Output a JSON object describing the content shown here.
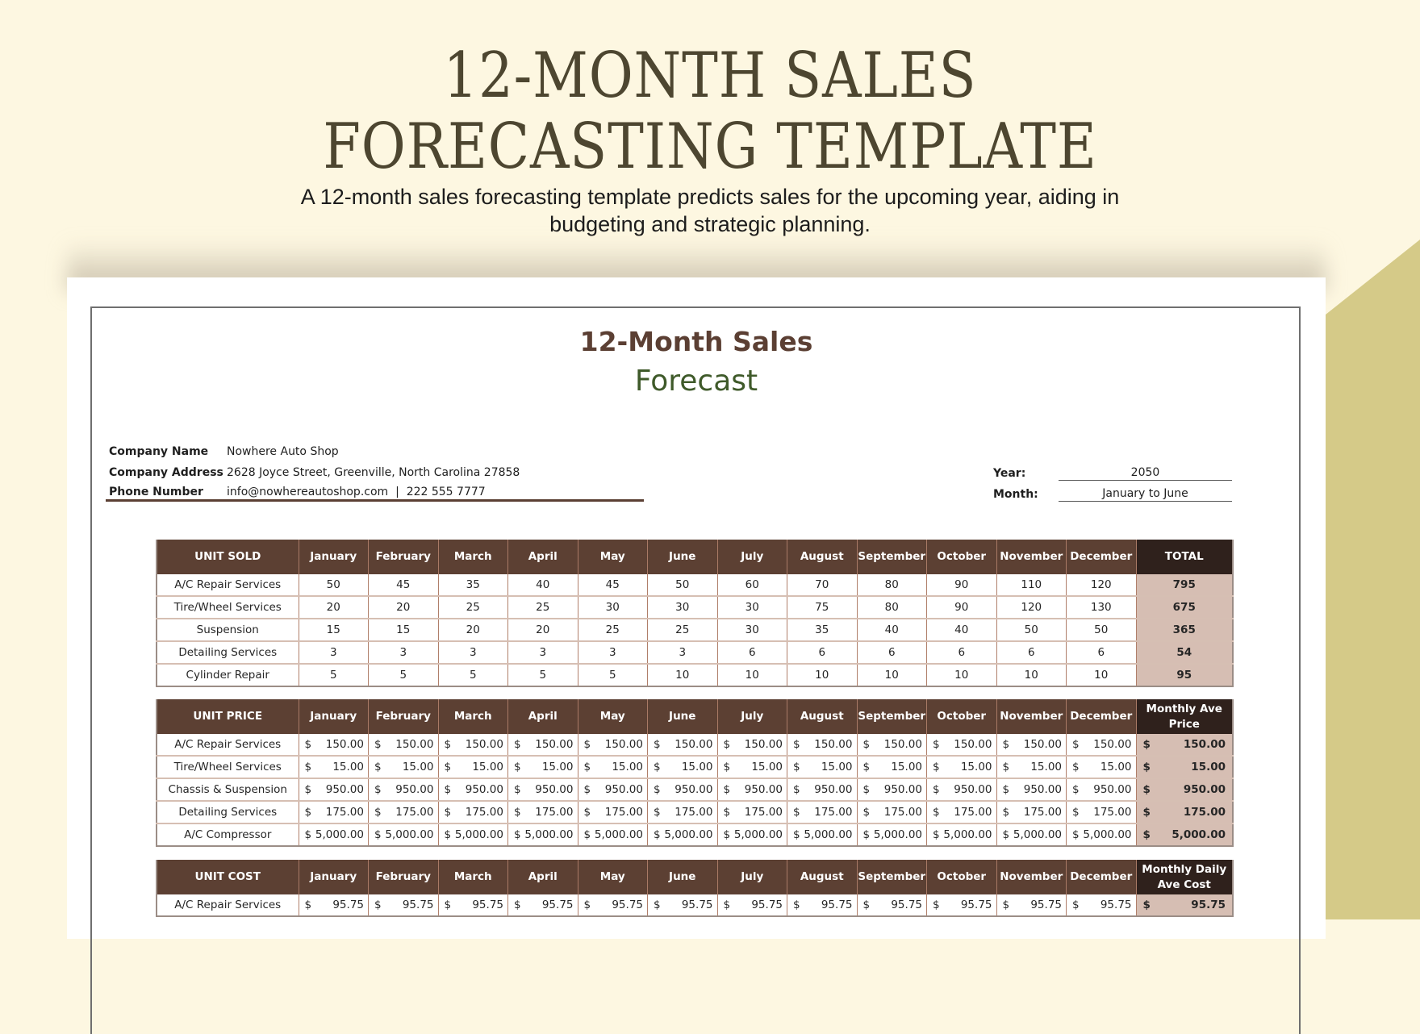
{
  "hero": {
    "title_line1": "12-MONTH SALES",
    "title_line2": "FORECASTING TEMPLATE",
    "subtitle_line1": "A 12-month sales forecasting template predicts sales for the upcoming year, aiding in",
    "subtitle_line2": "budgeting and strategic planning."
  },
  "document": {
    "title": "12-Month Sales",
    "subtitle": "Forecast",
    "company": {
      "name_label": "Company Name",
      "name": "Nowhere Auto Shop",
      "address_label": "Company Address",
      "address": "2628 Joyce Street, Greenville, North Carolina 27858",
      "phone_label": "Phone Number",
      "phone": "info@nowhereautoshop.com  |  222 555 7777"
    },
    "period": {
      "year_label": "Year:",
      "year": "2050",
      "month_label": "Month:",
      "month": "January to June"
    }
  },
  "months": [
    "January",
    "February",
    "March",
    "April",
    "May",
    "June",
    "July",
    "August",
    "September",
    "October",
    "November",
    "December"
  ],
  "colors": {
    "header_brown": "#5c4033",
    "total_header": "#2f211c",
    "total_cell": "#d6beb3",
    "title_brown": "#5b3f33",
    "title_green": "#3f5a2a",
    "background": "#fdf7e1",
    "accent_gold": "#d5ca88"
  },
  "unit_sold": {
    "header": "UNIT SOLD",
    "total_header": "TOTAL",
    "rows": [
      {
        "name": "A/C Repair Services",
        "values": [
          "50",
          "45",
          "35",
          "40",
          "45",
          "50",
          "60",
          "70",
          "80",
          "90",
          "110",
          "120"
        ],
        "total": "795"
      },
      {
        "name": "Tire/Wheel Services",
        "values": [
          "20",
          "20",
          "25",
          "25",
          "30",
          "30",
          "30",
          "75",
          "80",
          "90",
          "120",
          "130"
        ],
        "total": "675"
      },
      {
        "name": "Suspension",
        "values": [
          "15",
          "15",
          "20",
          "20",
          "25",
          "25",
          "30",
          "35",
          "40",
          "40",
          "50",
          "50"
        ],
        "total": "365"
      },
      {
        "name": "Detailing Services",
        "values": [
          "3",
          "3",
          "3",
          "3",
          "3",
          "3",
          "6",
          "6",
          "6",
          "6",
          "6",
          "6"
        ],
        "total": "54"
      },
      {
        "name": "Cylinder Repair",
        "values": [
          "5",
          "5",
          "5",
          "5",
          "5",
          "10",
          "10",
          "10",
          "10",
          "10",
          "10",
          "10"
        ],
        "total": "95"
      }
    ]
  },
  "unit_price": {
    "header": "UNIT PRICE",
    "total_header_line1": "Monthly Ave",
    "total_header_line2": "Price",
    "currency": "$",
    "rows": [
      {
        "name": "A/C Repair Services",
        "values": [
          "150.00",
          "150.00",
          "150.00",
          "150.00",
          "150.00",
          "150.00",
          "150.00",
          "150.00",
          "150.00",
          "150.00",
          "150.00",
          "150.00"
        ],
        "total": "150.00"
      },
      {
        "name": "Tire/Wheel Services",
        "values": [
          "15.00",
          "15.00",
          "15.00",
          "15.00",
          "15.00",
          "15.00",
          "15.00",
          "15.00",
          "15.00",
          "15.00",
          "15.00",
          "15.00"
        ],
        "total": "15.00"
      },
      {
        "name": "Chassis & Suspension",
        "values": [
          "950.00",
          "950.00",
          "950.00",
          "950.00",
          "950.00",
          "950.00",
          "950.00",
          "950.00",
          "950.00",
          "950.00",
          "950.00",
          "950.00"
        ],
        "total": "950.00"
      },
      {
        "name": "Detailing Services",
        "values": [
          "175.00",
          "175.00",
          "175.00",
          "175.00",
          "175.00",
          "175.00",
          "175.00",
          "175.00",
          "175.00",
          "175.00",
          "175.00",
          "175.00"
        ],
        "total": "175.00"
      },
      {
        "name": "A/C Compressor",
        "values": [
          "5,000.00",
          "5,000.00",
          "5,000.00",
          "5,000.00",
          "5,000.00",
          "5,000.00",
          "5,000.00",
          "5,000.00",
          "5,000.00",
          "5,000.00",
          "5,000.00",
          "5,000.00"
        ],
        "total": "5,000.00"
      }
    ]
  },
  "unit_cost": {
    "header": "UNIT COST",
    "total_header_line1": "Monthly Daily",
    "total_header_line2": "Ave Cost",
    "currency": "$",
    "rows": [
      {
        "name": "A/C Repair Services",
        "values": [
          "95.75",
          "95.75",
          "95.75",
          "95.75",
          "95.75",
          "95.75",
          "95.75",
          "95.75",
          "95.75",
          "95.75",
          "95.75",
          "95.75"
        ],
        "total": "95.75"
      }
    ]
  }
}
